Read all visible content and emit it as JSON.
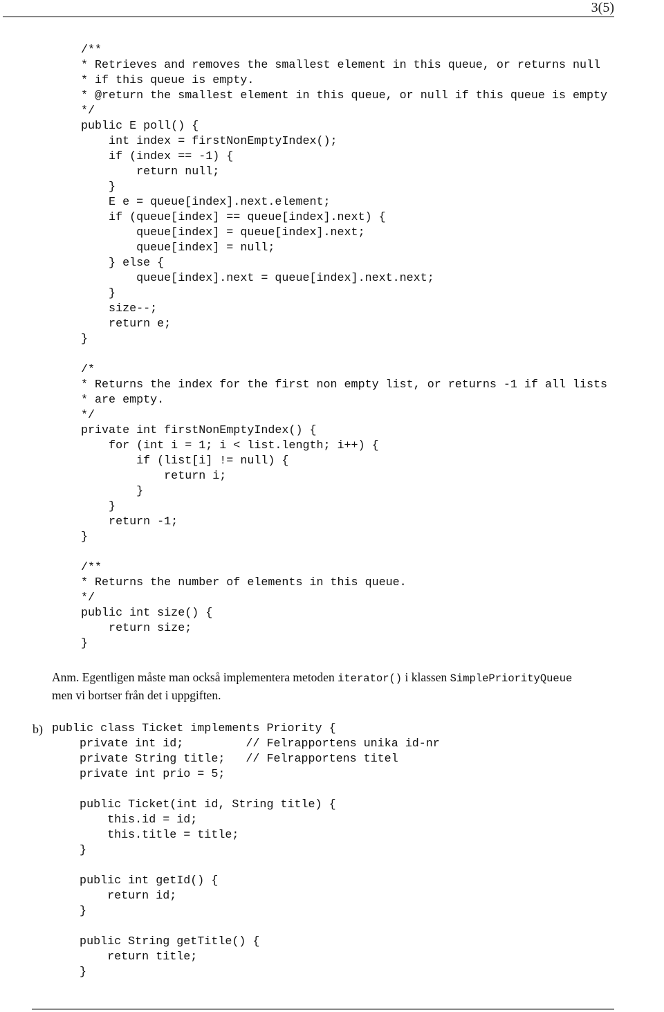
{
  "header": {
    "page_number": "3(5)"
  },
  "poll_block": {
    "lines": [
      "/**",
      "* Retrieves and removes the smallest element in this queue, or returns null",
      "* if this queue is empty.",
      "* @return the smallest element in this queue, or null if this queue is empty",
      "*/",
      "public E poll() {",
      "    int index = firstNonEmptyIndex();",
      "    if (index == -1) {",
      "        return null;",
      "    }",
      "    E e = queue[index].next.element;",
      "    if (queue[index] == queue[index].next) {",
      "        queue[index] = queue[index].next;",
      "        queue[index] = null;",
      "    } else {",
      "        queue[index].next = queue[index].next.next;",
      "    }",
      "    size--;",
      "    return e;",
      "}"
    ]
  },
  "first_non_empty_block": {
    "lines": [
      "/*",
      "* Returns the index for the first non empty list, or returns -1 if all lists",
      "* are empty.",
      "*/",
      "private int firstNonEmptyIndex() {",
      "    for (int i = 1; i < list.length; i++) {",
      "        if (list[i] != null) {",
      "            return i;",
      "        }",
      "    }",
      "    return -1;",
      "}"
    ]
  },
  "size_block": {
    "lines": [
      "/**",
      "* Returns the number of elements in this queue.",
      "*/",
      "public int size() {",
      "    return size;",
      "}"
    ]
  },
  "note": {
    "prefix": "Anm. Egentligen måste man också implementera metoden ",
    "method": "iterator()",
    "middle": " i klassen ",
    "class_name": "SimplePriorityQueue",
    "line2": "men vi bortser från det i uppgiften."
  },
  "part_b": {
    "label": "b)",
    "lines": [
      "public class Ticket implements Priority {",
      "    private int id;         // Felrapportens unika id-nr",
      "    private String title;   // Felrapportens titel",
      "    private int prio = 5;",
      "",
      "    public Ticket(int id, String title) {",
      "        this.id = id;",
      "        this.title = title;",
      "    }",
      "",
      "    public int getId() {",
      "        return id;",
      "    }",
      "",
      "    public String getTitle() {",
      "        return title;",
      "    }"
    ]
  }
}
